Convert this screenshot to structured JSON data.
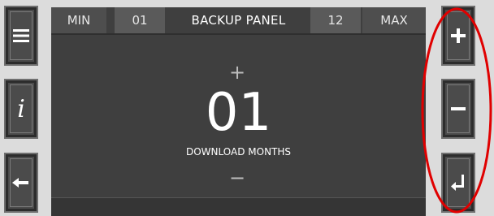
{
  "left_buttons": {
    "menu": "menu-icon",
    "info": "info-icon",
    "back": "back-arrow-icon"
  },
  "right_buttons": {
    "plus": "plus-icon",
    "minus": "minus-icon",
    "enter": "enter-icon"
  },
  "panel": {
    "title": "BACKUP PANEL",
    "min_label": "MIN",
    "min_value": "01",
    "max_value": "12",
    "max_label": "MAX",
    "current_value": "01",
    "caption": "DOWNLOAD MONTHS",
    "increment_symbol": "+",
    "decrement_symbol": "−"
  },
  "colors": {
    "annotation": "#e00000",
    "panel": "#3f3f3f",
    "button": "#4b4b4b"
  }
}
